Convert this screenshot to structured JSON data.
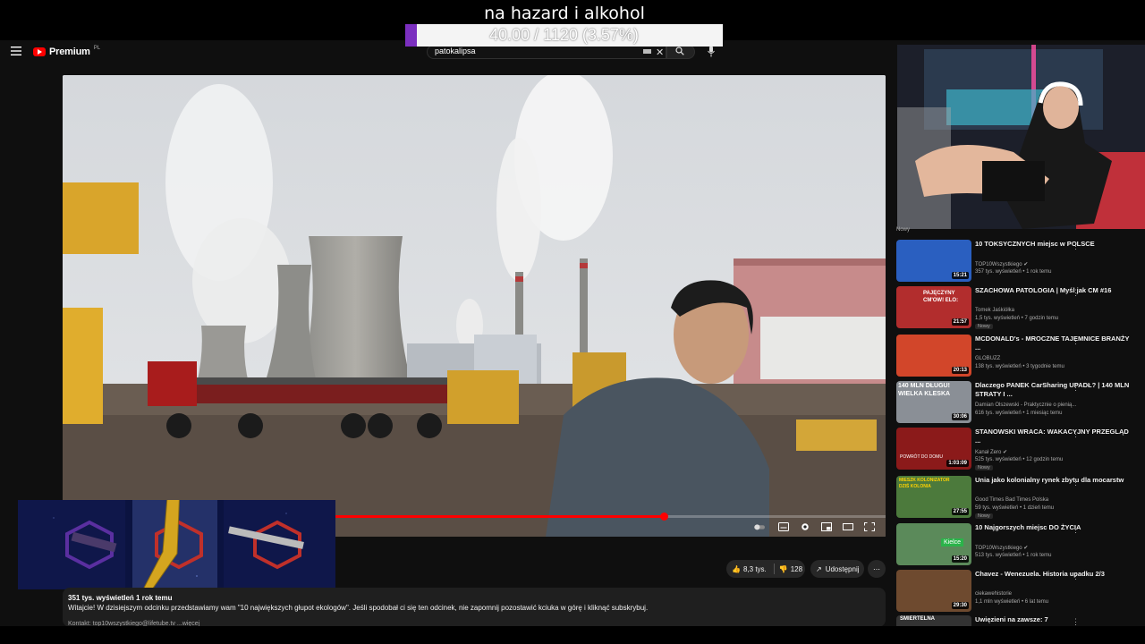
{
  "overlay": {
    "title": "na hazard i alkohol",
    "progress_text": "40.00 / 1120 (3.57%)",
    "progress_fraction": 0.0357,
    "accent": "#7b2fbf"
  },
  "header": {
    "logo_text": "Premium",
    "logo_region": "PL",
    "search_value": "patokalipsa",
    "icons": [
      "menu-icon",
      "keyboard-icon",
      "clear-icon",
      "search-icon",
      "mic-icon"
    ]
  },
  "player": {
    "progress_fraction": 0.73,
    "accent": "#ff0000"
  },
  "actions": {
    "like_count": "8,3 tys.",
    "dislike_count": "128",
    "share_label": "Udostępnij",
    "more_label": "⋯"
  },
  "description": {
    "views": "351 tys. wyświetleń   1 rok temu",
    "text": "Witajcie! W dzisiejszym odcinku przedstawiamy wam \"10 największych głupot ekologów\". Jeśli spodobał ci się ten odcinek, nie zapomnij pozostawić kciuka w górę i kliknąć subskrybuj.",
    "more": "Kontakt: top10wszystkiego@lifetube.tv   ...więcej"
  },
  "sidebar": {
    "top_label": "Nowy",
    "items": [
      {
        "title": "10 TOKSYCZNYCH miejsc w POLSCE",
        "channel": "TOP10Wszystkiego ✔",
        "meta": "357 tys. wyświetleń • 1 rok temu",
        "duration": "15:21",
        "badge": "",
        "thumb": "#2a5fc0"
      },
      {
        "title": "SZACHOWA PATOLOGIA | Myśl jak CM #16",
        "channel": "Tomek Jaśkiółka",
        "meta": "1,5 tys. wyświetleń • 7 godzin temu",
        "duration": "21:57",
        "badge": "Nowy",
        "thumb": "#b22d2d"
      },
      {
        "title": "MCDONALD's - MROCZNE TAJEMNICE BRANŻY ...",
        "channel": "GLOBUZZ",
        "meta": "138 tys. wyświetleń • 3 tygodnie temu",
        "duration": "20:13",
        "badge": "",
        "thumb": "#d2462a"
      },
      {
        "title": "Dlaczego PANEK CarSharing UPADŁ? | 140 MLN STRATY I ...",
        "channel": "Damian Olszewski - Praktycznie o pienią...",
        "meta": "616 tys. wyświetleń • 1 miesiąc temu",
        "duration": "30:06",
        "badge": "",
        "thumb": "#8a8f96"
      },
      {
        "title": "STANOWSKI WRACA: WAKACYJNY PRZEGLĄD ...",
        "channel": "Kanał Zero ✔",
        "meta": "525 tys. wyświetleń • 12 godzin temu",
        "duration": "1:03:09",
        "badge": "Nowy",
        "thumb": "#8b1a1a"
      },
      {
        "title": "Unia jako kolonialny rynek zbytu dla mocarstw",
        "channel": "Good Times Bad Times Polska",
        "meta": "59 tys. wyświetleń • 1 dzień temu",
        "duration": "27:55",
        "badge": "Nowy",
        "thumb": "#4c7a3c"
      },
      {
        "title": "10 Najgorszych miejsc DO ŻYCIA",
        "channel": "TOP10Wszystkiego ✔",
        "meta": "513 tys. wyświetleń • 1 rok temu",
        "duration": "15:20",
        "badge": "",
        "thumb": "#5b8a5a",
        "thumb_label": "Kielce"
      },
      {
        "title": "Chavez - Wenezuela. Historia upadku 2/3",
        "channel": "ciekawehistorie",
        "meta": "1,1 mln wyświetleń • 6 lat temu",
        "duration": "29:30",
        "badge": "",
        "thumb": "#6e4a2f"
      },
      {
        "title": "Uwięzieni na zawsze: 7",
        "channel": "",
        "meta": "",
        "duration": "",
        "badge": "",
        "thumb": "#333333"
      }
    ]
  },
  "thumb_texts": {
    "t2": "PAJĘCZYNY CM'OW! ELO:",
    "t4": "140 MLN DŁUGU! WIELKA KLESKA",
    "t5": "POWRÓT DO DOMU",
    "t6": "MIESZK KOLONIZATOR DZIŚ KOLONIA",
    "t9": "ŚMIERTELNA"
  }
}
